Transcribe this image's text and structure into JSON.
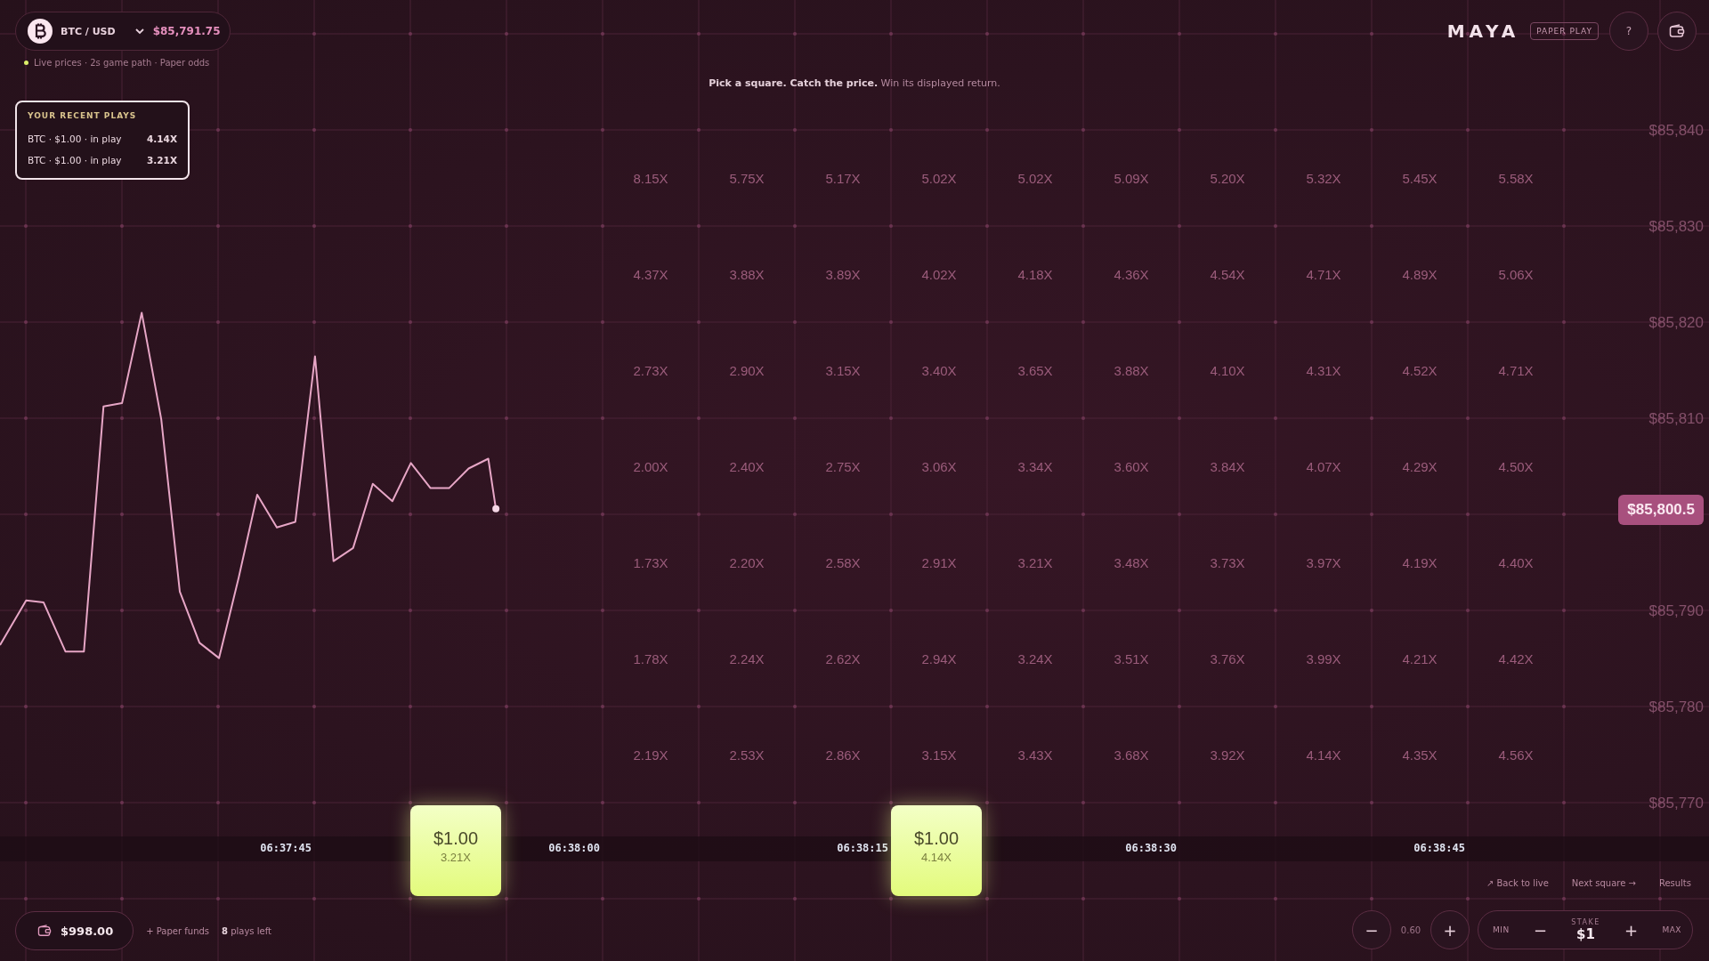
{
  "pair_selector": {
    "symbol": "BTC / USD",
    "price": "$85,791.75"
  },
  "status": "Live prices · 2s game path · Paper odds",
  "recent_plays": {
    "title": "YOUR RECENT PLAYS",
    "items": [
      {
        "label": "BTC · $1.00 · in play",
        "multiplier": "4.14X"
      },
      {
        "label": "BTC · $1.00 · in play",
        "multiplier": "3.21X"
      }
    ]
  },
  "brand": {
    "name": "MAYA",
    "badge": "PAPER PLAY"
  },
  "help_button": "?",
  "tagline": "**Pick a square. Catch the price.** Win its displayed return.",
  "multiplier_grid": [
    [
      "8.15X",
      "5.75X",
      "5.17X",
      "5.02X",
      "5.02X",
      "5.09X",
      "5.20X",
      "5.32X",
      "5.45X",
      "5.58X"
    ],
    [
      "4.37X",
      "3.88X",
      "3.89X",
      "4.02X",
      "4.18X",
      "4.36X",
      "4.54X",
      "4.71X",
      "4.89X",
      "5.06X"
    ],
    [
      "2.73X",
      "2.90X",
      "3.15X",
      "3.40X",
      "3.65X",
      "3.88X",
      "4.10X",
      "4.31X",
      "4.52X",
      "4.71X"
    ],
    [
      "2.00X",
      "2.40X",
      "2.75X",
      "3.06X",
      "3.34X",
      "3.60X",
      "3.84X",
      "4.07X",
      "4.29X",
      "4.50X"
    ],
    [
      "1.73X",
      "2.20X",
      "2.58X",
      "2.91X",
      "3.21X",
      "3.48X",
      "3.73X",
      "3.97X",
      "4.19X",
      "4.40X"
    ],
    [
      "1.78X",
      "2.24X",
      "2.62X",
      "2.94X",
      "3.24X",
      "3.51X",
      "3.76X",
      "3.99X",
      "4.21X",
      "4.42X"
    ],
    [
      "2.19X",
      "2.53X",
      "2.86X",
      "3.15X",
      "3.43X",
      "3.68X",
      "3.92X",
      "4.14X",
      "4.35X",
      "4.56X"
    ]
  ],
  "price_axis": [
    "$85,840",
    "$85,830",
    "$85,820",
    "$85,810",
    "$85,790",
    "$85,780",
    "$85,770"
  ],
  "current_price": "$85,800.5",
  "time_axis": [
    "06:37:45",
    "06:38:00",
    "06:38:15",
    "06:38:30",
    "06:38:45"
  ],
  "bets": [
    {
      "stake": "$1.00",
      "multiplier": "3.21X"
    },
    {
      "stake": "$1.00",
      "multiplier": "4.14X"
    }
  ],
  "nav_links": [
    "↗ Back to live",
    "Next square →",
    "Results"
  ],
  "balance": "$998.00",
  "paper_funds": "+ Paper funds",
  "plays_left": {
    "count": "8",
    "label": "plays left"
  },
  "zoom_control": {
    "minus": "−",
    "value": "0.60",
    "plus": "+"
  },
  "stake_control": {
    "min": "MIN",
    "minus": "−",
    "label": "STAKE",
    "value": "$1",
    "plus": "+",
    "max": "MAX"
  }
}
